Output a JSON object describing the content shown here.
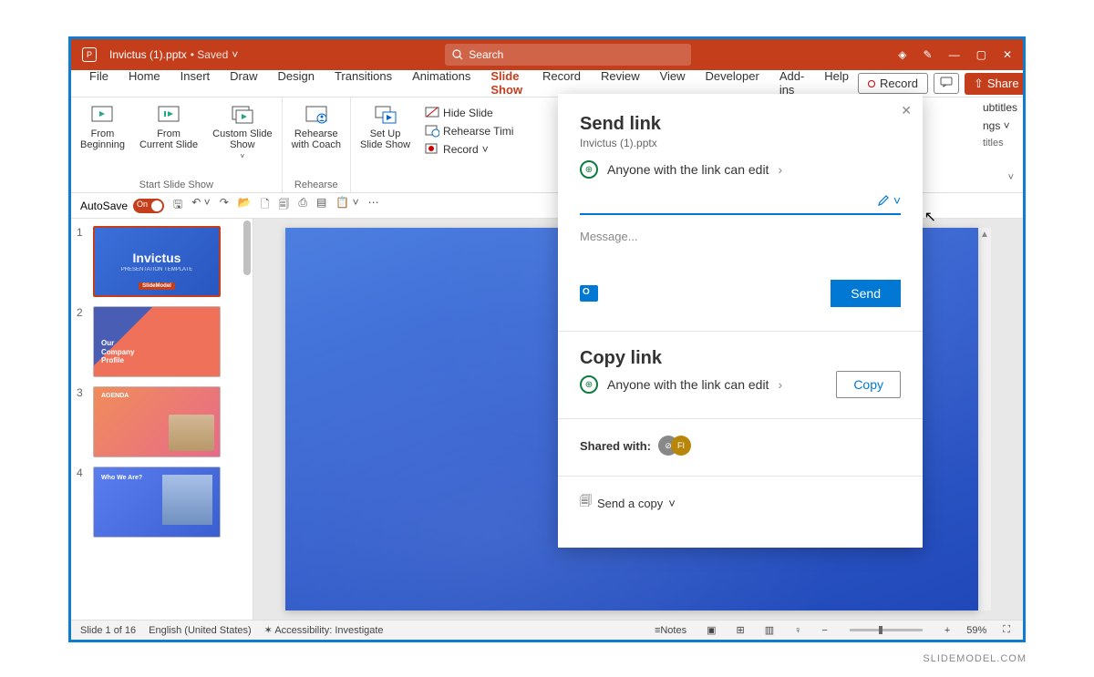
{
  "titlebar": {
    "filename": "Invictus (1).pptx",
    "saved_label": "• Saved",
    "search_placeholder": "Search"
  },
  "menubar": {
    "tabs": [
      "File",
      "Home",
      "Insert",
      "Draw",
      "Design",
      "Transitions",
      "Animations",
      "Slide Show",
      "Record",
      "Review",
      "View",
      "Developer",
      "Add-ins",
      "Help"
    ],
    "active_tab": "Slide Show",
    "record": "Record",
    "share": "Share"
  },
  "ribbon": {
    "from_beginning": "From\nBeginning",
    "from_current": "From\nCurrent Slide",
    "custom_show": "Custom Slide\nShow",
    "start_label": "Start Slide Show",
    "rehearse_coach": "Rehearse\nwith Coach",
    "rehearse_label": "Rehearse",
    "setup": "Set Up\nSlide Show",
    "hide_slide": "Hide Slide",
    "rehearse_timings": "Rehearse Timi",
    "record_mini": "Record",
    "subtitles1": "ubtitles",
    "subtitles_settings": "ngs",
    "subtitles2": "titles"
  },
  "qat": {
    "autosave": "AutoSave",
    "toggle_on": "On"
  },
  "thumbnails": {
    "s1_title": "Invictus",
    "s1_sub": "PRESENTATION TEMPLATE",
    "s1_badge": "SlideModel",
    "s2_text": "Our\nCompany\nProfile",
    "s3_text": "AGENDA",
    "s4_text": "Who We Are?"
  },
  "share": {
    "title": "Send link",
    "filename": "Invictus (1).pptx",
    "permission": "Anyone with the link can edit",
    "message_placeholder": "Message...",
    "send": "Send",
    "copy_title": "Copy link",
    "copy_btn": "Copy",
    "shared_with": "Shared with:",
    "avatar2": "FI",
    "send_copy": "Send a copy"
  },
  "statusbar": {
    "slide_pos": "Slide 1 of 16",
    "language": "English (United States)",
    "accessibility": "Accessibility: Investigate",
    "notes": "Notes",
    "zoom": "59%"
  },
  "watermark": "SLIDEMODEL.COM"
}
